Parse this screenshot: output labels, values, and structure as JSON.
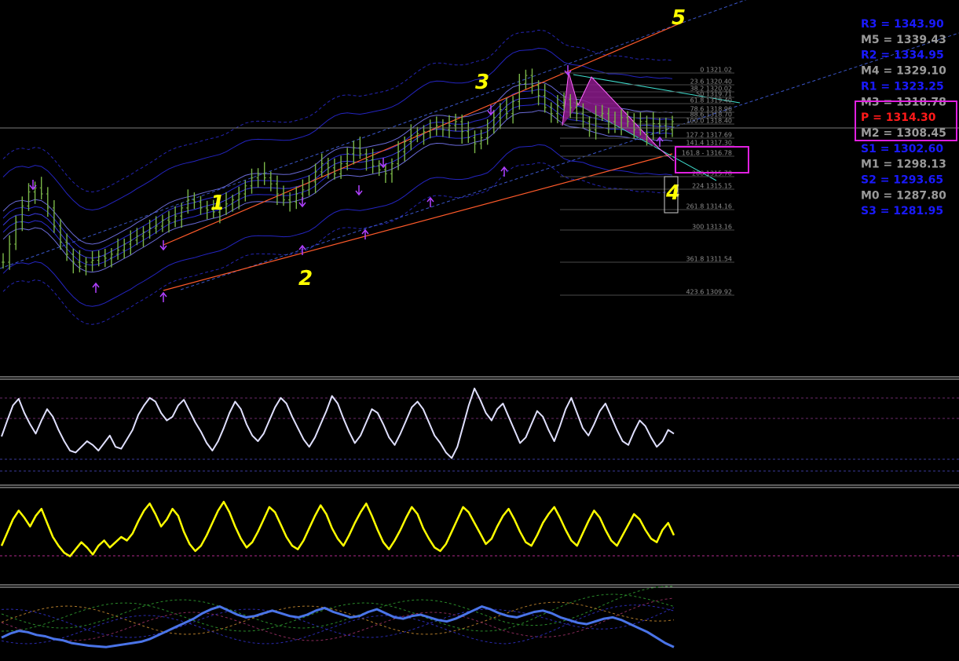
{
  "colors": {
    "background": "#000000",
    "price_bars": "#7ab648",
    "channel_lines": "#ff5a2a",
    "dotted_trend": "#3a55c8",
    "bands": "#2a2ad0",
    "pattern_fill": "#8b1a8b",
    "arrow_marker": "#b040ff",
    "wave_labels": "#ffff00",
    "highlight_box": "#e020e0",
    "osc1": "#e0e0ff",
    "osc2": "#ffff00",
    "osc3": "#4a74e8",
    "pivot_blue": "#1a1aff",
    "pivot_gray": "#9a9a9a",
    "pivot_red": "#ff1a1a"
  },
  "chart_data": [
    {
      "type": "line",
      "panel": "price",
      "description": "",
      "series": [
        {
          "name": "",
          "values": [
            1311.6,
            1312.5,
            1313.6,
            1314.4,
            1315.1,
            1315.3,
            1315.0,
            1314.3,
            1313.4,
            1312.6,
            1312.0,
            1311.6,
            1311.4,
            1311.6,
            1311.7,
            1311.9,
            1311.8,
            1312.0,
            1312.2,
            1312.5,
            1312.7,
            1312.9,
            1313.1,
            1313.3,
            1313.4,
            1313.7,
            1313.6,
            1313.9,
            1314.3,
            1314.7,
            1314.6,
            1314.3,
            1314.2,
            1314.1,
            1314.3,
            1314.5,
            1314.7,
            1315.0,
            1315.4,
            1315.8,
            1316.0,
            1315.8,
            1315.5,
            1315.0,
            1314.7,
            1314.6,
            1315.0,
            1315.2,
            1315.6,
            1316.1,
            1316.5,
            1316.3,
            1316.0,
            1316.5,
            1317.0,
            1317.3,
            1317.0,
            1316.7,
            1316.4,
            1316.2,
            1316.0,
            1316.5,
            1317.1,
            1317.6,
            1317.9,
            1318.0,
            1318.1,
            1318.3,
            1318.4,
            1318.2,
            1318.4,
            1318.6,
            1318.1,
            1317.8,
            1317.5,
            1317.8,
            1318.3,
            1318.8,
            1319.2,
            1319.0,
            1319.6,
            1320.5,
            1320.9,
            1320.4,
            1319.9,
            1319.3,
            1319.0,
            1319.4,
            1319.7,
            1319.3,
            1319.0,
            1318.6,
            1318.2,
            1318.9,
            1319.0,
            1318.6,
            1318.3,
            1318.8,
            1318.6,
            1318.2,
            1318.6,
            1318.0,
            1318.5,
            1318.4,
            1318.2,
            1318.6
          ]
        }
      ],
      "fibonacci_levels": [
        {
          "label": "0 1321.02"
        },
        {
          "label": "23.6 1320.40"
        },
        {
          "label": "38.2 1320.02"
        },
        {
          "label": "50 1319.71"
        },
        {
          "label": "61.8 1319.40"
        },
        {
          "label": "78.6 1318.96"
        },
        {
          "label": "88.6 1318.70"
        },
        {
          "label": "100.0 1318.40"
        },
        {
          "label": "127.2 1317.69"
        },
        {
          "label": "141.4 1317.30"
        },
        {
          "label": "161.8 - 1316.78"
        },
        {
          "label": "200 1315.78"
        },
        {
          "label": "224 1315.15"
        },
        {
          "label": "261.8 1314.16"
        },
        {
          "label": "300 1313.16"
        },
        {
          "label": "361.8 1311.54"
        },
        {
          "label": "423.6 1309.92"
        }
      ],
      "wave_labels": [
        "1",
        "2",
        "3",
        "4",
        "5"
      ]
    },
    {
      "type": "line",
      "panel": "oscillator-1",
      "series": [
        {
          "name": "",
          "values": [
            45,
            62,
            78,
            85,
            70,
            58,
            48,
            62,
            74,
            66,
            52,
            40,
            30,
            28,
            34,
            40,
            36,
            30,
            38,
            46,
            34,
            32,
            42,
            52,
            68,
            78,
            86,
            82,
            70,
            62,
            66,
            78,
            84,
            72,
            60,
            50,
            38,
            30,
            40,
            54,
            70,
            82,
            74,
            58,
            46,
            40,
            48,
            62,
            76,
            86,
            80,
            66,
            54,
            42,
            34,
            44,
            58,
            72,
            88,
            80,
            64,
            50,
            38,
            46,
            60,
            74,
            70,
            58,
            44,
            36,
            48,
            62,
            76,
            82,
            74,
            60,
            46,
            38,
            28,
            22,
            34,
            56,
            78,
            96,
            84,
            70,
            62,
            74,
            80,
            66,
            52,
            38,
            44,
            58,
            72,
            66,
            52,
            40,
            56,
            74,
            86,
            70,
            54,
            46,
            58,
            72,
            80,
            66,
            52,
            40,
            36,
            50,
            62,
            56,
            44,
            34,
            40,
            52,
            48
          ]
        }
      ]
    },
    {
      "type": "line",
      "panel": "oscillator-2",
      "series": [
        {
          "name": "",
          "values": [
            40,
            55,
            70,
            80,
            72,
            62,
            74,
            82,
            66,
            50,
            40,
            32,
            28,
            36,
            44,
            38,
            30,
            40,
            46,
            38,
            44,
            50,
            46,
            54,
            68,
            80,
            88,
            76,
            62,
            70,
            82,
            74,
            56,
            42,
            34,
            40,
            52,
            66,
            80,
            90,
            78,
            62,
            48,
            38,
            44,
            56,
            70,
            84,
            78,
            64,
            50,
            40,
            36,
            46,
            60,
            74,
            86,
            76,
            60,
            48,
            40,
            52,
            66,
            78,
            88,
            74,
            58,
            44,
            36,
            46,
            58,
            72,
            84,
            76,
            60,
            48,
            38,
            34,
            42,
            56,
            70,
            84,
            78,
            66,
            54,
            42,
            48,
            62,
            74,
            82,
            70,
            56,
            44,
            40,
            52,
            66,
            76,
            84,
            72,
            58,
            46,
            40,
            54,
            68,
            80,
            72,
            58,
            46,
            40,
            52,
            64,
            76,
            70,
            58,
            48,
            44,
            58,
            66,
            52
          ]
        }
      ]
    },
    {
      "type": "line",
      "panel": "oscillator-3",
      "series": [
        {
          "name": "",
          "values": [
            30,
            36,
            40,
            38,
            34,
            32,
            28,
            26,
            22,
            20,
            18,
            17,
            16,
            18,
            20,
            22,
            24,
            28,
            34,
            40,
            46,
            52,
            58,
            66,
            72,
            76,
            70,
            64,
            60,
            62,
            66,
            70,
            66,
            62,
            60,
            64,
            70,
            74,
            68,
            64,
            60,
            62,
            68,
            72,
            66,
            60,
            58,
            62,
            64,
            60,
            56,
            54,
            58,
            64,
            70,
            76,
            72,
            66,
            62,
            60,
            64,
            68,
            70,
            66,
            60,
            56,
            52,
            50,
            54,
            58,
            60,
            56,
            50,
            44,
            38,
            30,
            22,
            16
          ]
        }
      ]
    }
  ],
  "pivots": [
    {
      "label": "R3 = 1343.90",
      "color": "#1a1aff"
    },
    {
      "label": "M5 = 1339.43",
      "color": "#9a9a9a"
    },
    {
      "label": "R2 = 1334.95",
      "color": "#1a1aff"
    },
    {
      "label": "M4 = 1329.10",
      "color": "#9a9a9a"
    },
    {
      "label": "R1 = 1323.25",
      "color": "#1a1aff"
    },
    {
      "label": "M3 = 1318.78",
      "color": "#9a9a9a"
    },
    {
      "label": "P  = 1314.30",
      "color": "#ff1a1a"
    },
    {
      "label": "M2 = 1308.45",
      "color": "#9a9a9a"
    },
    {
      "label": "S1 = 1302.60",
      "color": "#1a1aff"
    },
    {
      "label": "M1 = 1298.13",
      "color": "#9a9a9a"
    },
    {
      "label": "S2 = 1293.65",
      "color": "#1a1aff"
    },
    {
      "label": "M0 = 1287.80",
      "color": "#9a9a9a"
    },
    {
      "label": "S3 = 1281.95",
      "color": "#1a1aff"
    }
  ]
}
